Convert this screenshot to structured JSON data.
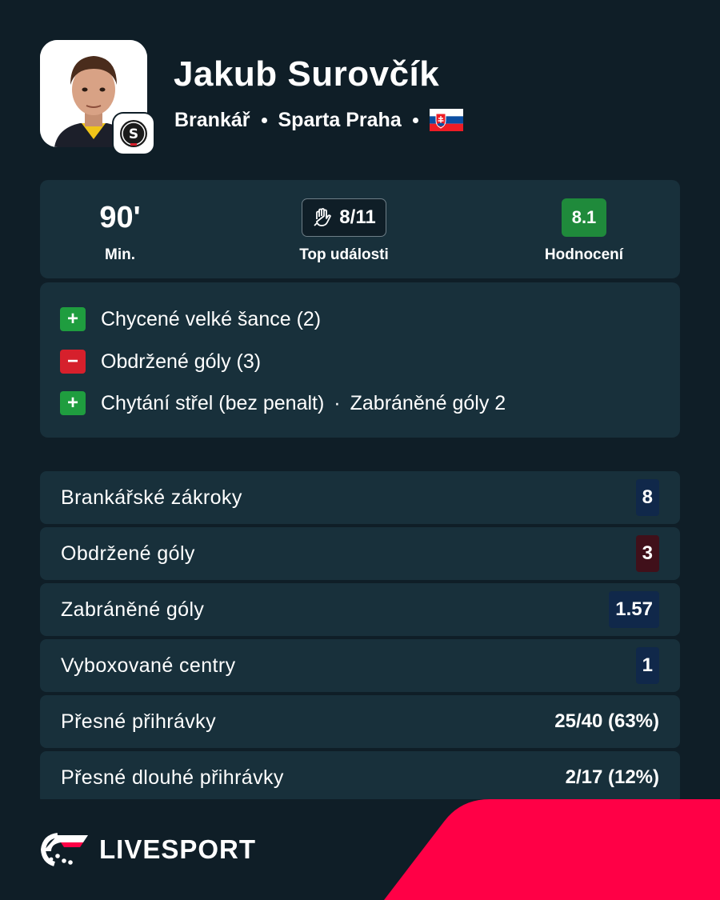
{
  "player": {
    "name": "Jakub Surovčík",
    "position": "Brankář",
    "club": "Sparta Praha",
    "club_badge_letter": "S",
    "nationality_flag": "slovakia-flag"
  },
  "summary": {
    "minutes": "90'",
    "minutes_label": "Min.",
    "top_events": "8/11",
    "top_events_label": "Top události",
    "rating": "8.1",
    "rating_label": "Hodnocení",
    "rating_color": "#1f8a3b"
  },
  "events": [
    {
      "sign": "+",
      "type": "positive",
      "text": "Chycené velké šance (2)"
    },
    {
      "sign": "−",
      "type": "negative",
      "text": "Obdržené góly (3)"
    },
    {
      "sign": "+",
      "type": "positive",
      "text": "Chytání střel (bez penalt)",
      "extra": "Zabráněné góly 2"
    }
  ],
  "events_separator": "·",
  "stats": [
    {
      "name": "Brankářské zákroky",
      "value": "8"
    },
    {
      "name": "Obdržené góly",
      "value": "3"
    },
    {
      "name": "Zabráněné góly",
      "value": "1.57"
    },
    {
      "name": "Vyboxované centry",
      "value": "1"
    },
    {
      "name": "Přesné přihrávky",
      "value": "25/40 (63%)"
    },
    {
      "name": "Přesné dlouhé přihrávky",
      "value": "2/17 (12%)"
    }
  ],
  "brand": {
    "logo_text": "LIVESPORT",
    "accent_color": "#ff0046"
  }
}
